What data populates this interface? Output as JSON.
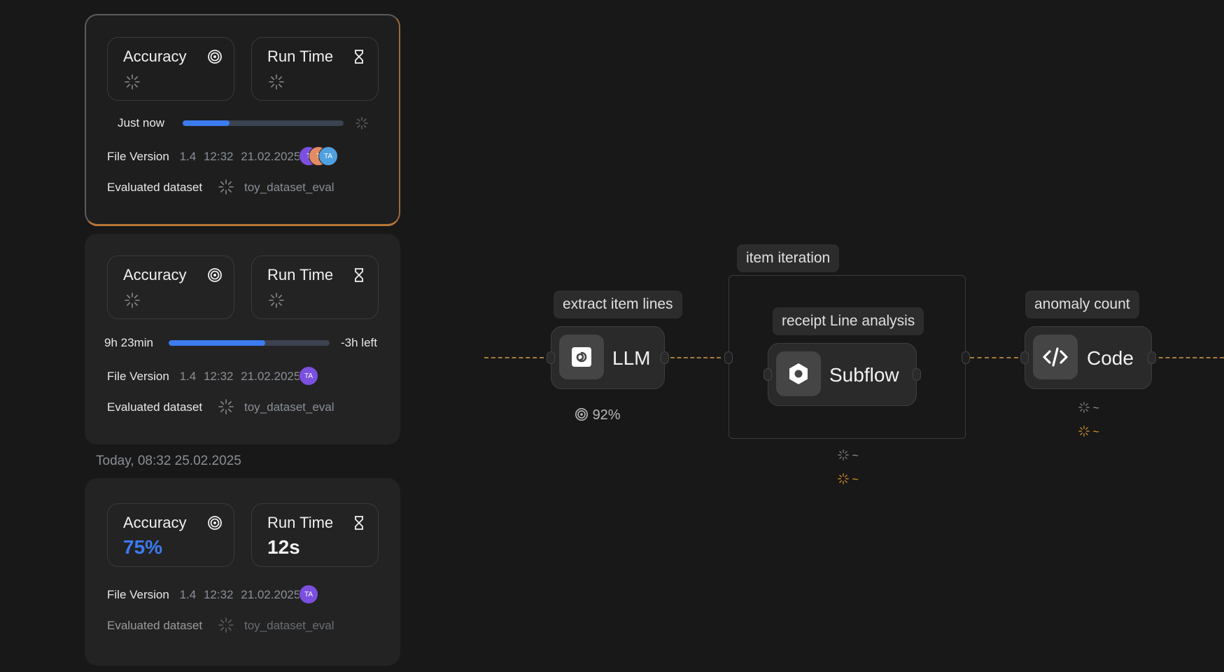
{
  "colors": {
    "accent": "#3c7bf0",
    "warning": "#e39a2b",
    "highlight_border": "#c07a35"
  },
  "runs": [
    {
      "accuracy_label": "Accuracy",
      "runtime_label": "Run Time",
      "progress_left": "Just now",
      "progress_right": "",
      "progress": 0.29,
      "file_version_label": "File Version",
      "version": "1.4",
      "time": "12:32",
      "date": "21.02.2025",
      "avatars": [
        "T",
        "T",
        "TA"
      ],
      "dataset_label": "Evaluated dataset",
      "dataset": "toy_dataset_eval"
    },
    {
      "accuracy_label": "Accuracy",
      "runtime_label": "Run Time",
      "progress_left": "9h 23min",
      "progress_right": "-3h left",
      "progress": 0.6,
      "file_version_label": "File Version",
      "version": "1.4",
      "time": "12:32",
      "date": "21.02.2025",
      "avatars": [
        "TA"
      ],
      "dataset_label": "Evaluated dataset",
      "dataset": "toy_dataset_eval"
    },
    {
      "accuracy_label": "Accuracy",
      "runtime_label": "Run Time",
      "accuracy_value": "75%",
      "runtime_value": "12s",
      "file_version_label": "File Version",
      "version": "1.4",
      "time": "12:32",
      "date": "21.02.2025",
      "avatars": [
        "TA"
      ],
      "dataset_label": "Evaluated dataset",
      "dataset": "toy_dataset_eval"
    }
  ],
  "group_date": "Today, 08:32 25.02.2025",
  "flow": {
    "llm": {
      "label": "extract item lines",
      "name": "LLM",
      "stat": "92%",
      "icon": "spiral-icon"
    },
    "iteration": {
      "label": "item iteration"
    },
    "subflow": {
      "label": "receipt Line analysis",
      "name": "Subflow",
      "icon": "hexagon-icon",
      "stat1": "~",
      "stat2": "~"
    },
    "code": {
      "label": "anomaly count",
      "name": "Code",
      "icon": "code-icon",
      "stat1": "~",
      "stat2": "~"
    }
  }
}
